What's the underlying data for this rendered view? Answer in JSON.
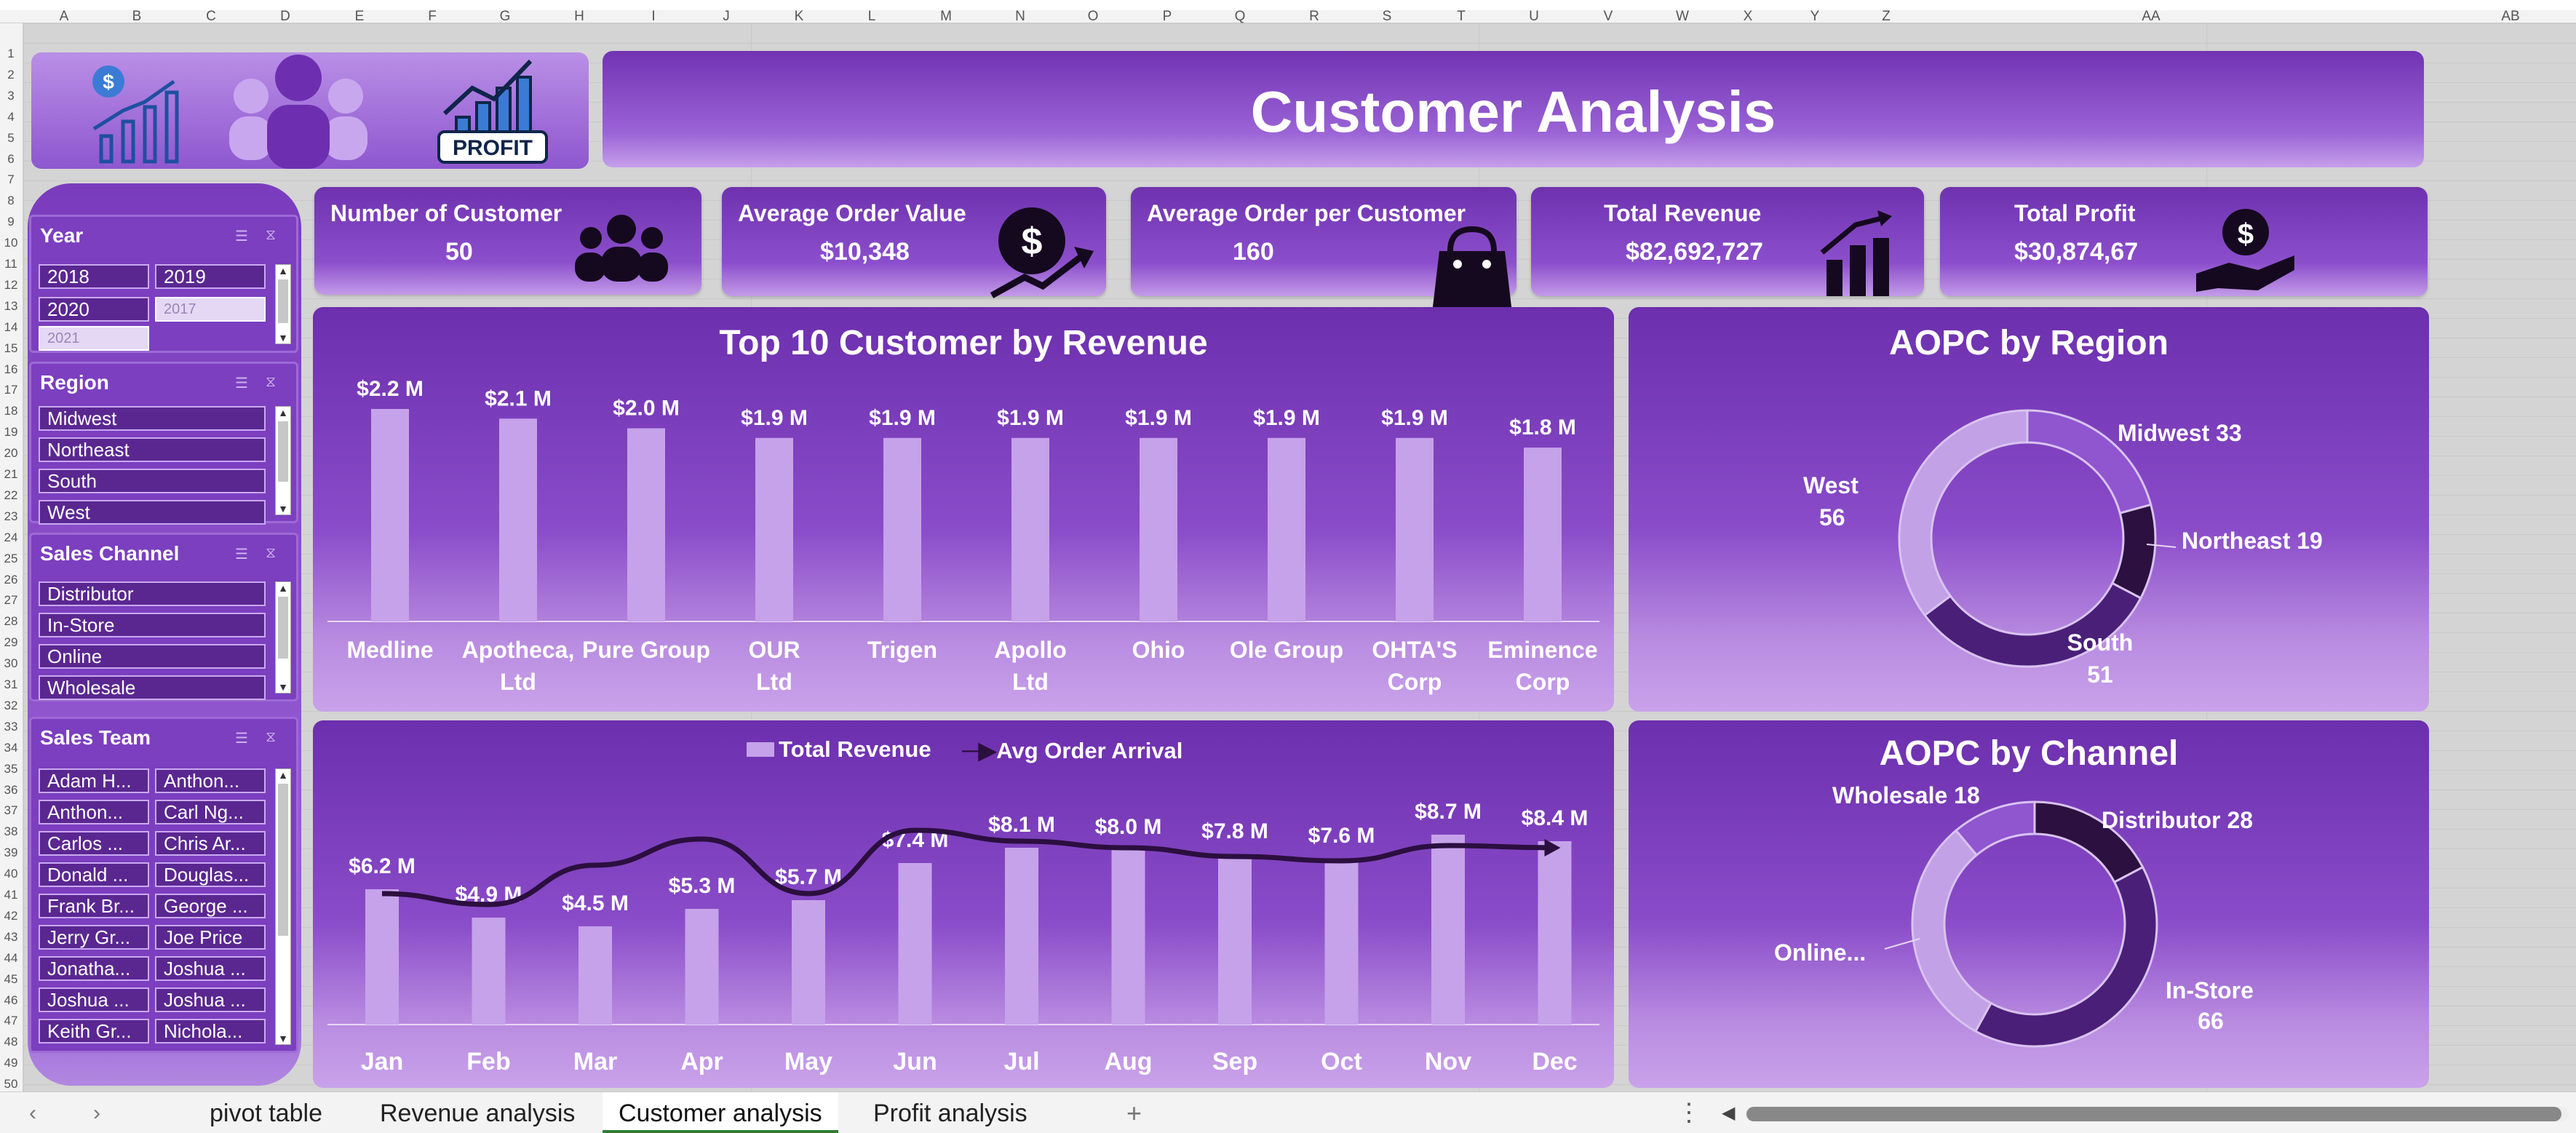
{
  "sheet": {
    "columns": [
      "A",
      "B",
      "C",
      "D",
      "E",
      "F",
      "G",
      "H",
      "I",
      "J",
      "K",
      "L",
      "M",
      "N",
      "O",
      "P",
      "Q",
      "R",
      "S",
      "T",
      "U",
      "V",
      "W",
      "X",
      "Y",
      "Z",
      "AA",
      "AB"
    ],
    "rows": [
      "1",
      "2",
      "3",
      "4",
      "5",
      "6",
      "7",
      "8",
      "9",
      "10",
      "11",
      "12",
      "13",
      "14",
      "15",
      "16",
      "17",
      "18",
      "19",
      "20",
      "21",
      "22",
      "23",
      "24",
      "25",
      "26",
      "27",
      "28",
      "29",
      "30",
      "31",
      "32",
      "33",
      "34",
      "35",
      "36",
      "37",
      "38",
      "39",
      "40",
      "41",
      "42",
      "43",
      "44",
      "45",
      "46",
      "47",
      "48",
      "49",
      "50"
    ]
  },
  "header": {
    "title": "Customer Analysis",
    "logo_badge": "PROFIT"
  },
  "kpis": [
    {
      "label": "Number of Customer",
      "value": "50",
      "icon": "people-icon"
    },
    {
      "label": "Average Order Value",
      "value": "$10,348",
      "icon": "dollar-growth-icon"
    },
    {
      "label": "Average Order per Customer",
      "value": "160",
      "icon": "shopping-bag-icon"
    },
    {
      "label": "Total Revenue",
      "value": "$82,692,727",
      "icon": "bar-growth-icon"
    },
    {
      "label": "Total Profit",
      "value": "$30,874,67",
      "icon": "money-hand-icon"
    }
  ],
  "slicers": {
    "year": {
      "title": "Year",
      "items": [
        "2018",
        "2019",
        "2020",
        "2017",
        "2021"
      ]
    },
    "region": {
      "title": "Region",
      "items": [
        "Midwest",
        "Northeast",
        "South",
        "West"
      ]
    },
    "channel": {
      "title": "Sales Channel",
      "items": [
        "Distributor",
        "In-Store",
        "Online",
        "Wholesale"
      ]
    },
    "team": {
      "title": "Sales Team",
      "items": [
        "Adam H...",
        "Anthon...",
        "Anthon...",
        "Carl Ng...",
        "Carlos ...",
        "Chris Ar...",
        "Donald ...",
        "Douglas...",
        "Frank Br...",
        "George ...",
        "Jerry Gr...",
        "Joe Price",
        "Jonatha...",
        "Joshua ...",
        "Joshua ...",
        "Joshua ...",
        "Keith Gr...",
        "Nichola..."
      ]
    }
  },
  "charts": {
    "top10_title": "Top 10 Customer by Revenue",
    "monthly_legend": {
      "bar": "Total Revenue",
      "line": "Avg Order Arrival"
    },
    "region_title": "AOPC by Region",
    "channel_title": "AOPC by Channel"
  },
  "chart_data": [
    {
      "type": "bar",
      "title": "Top 10 Customer by Revenue",
      "categories": [
        "Medline",
        "Apotheca, Ltd",
        "Pure Group",
        "OUR Ltd",
        "Trigen",
        "Apollo Ltd",
        "Ohio",
        "Ole Group",
        "OHTA'S Corp",
        "Eminence Corp"
      ],
      "values": [
        2.2,
        2.1,
        2.0,
        1.9,
        1.9,
        1.9,
        1.9,
        1.9,
        1.9,
        1.8
      ],
      "labels": [
        "$2.2 M",
        "$2.1 M",
        "$2.0 M",
        "$1.9 M",
        "$1.9 M",
        "$1.9 M",
        "$1.9 M",
        "$1.9 M",
        "$1.9 M",
        "$1.8 M"
      ]
    },
    {
      "type": "bar",
      "title": "",
      "categories": [
        "Jan",
        "Feb",
        "Mar",
        "Apr",
        "May",
        "Jun",
        "Jul",
        "Aug",
        "Sep",
        "Oct",
        "Nov",
        "Dec"
      ],
      "series": [
        {
          "name": "Total Revenue",
          "values": [
            6.2,
            4.9,
            4.5,
            5.3,
            5.7,
            7.4,
            8.1,
            8.0,
            7.8,
            7.6,
            8.7,
            8.4
          ],
          "labels": [
            "$6.2 M",
            "$4.9 M",
            "$4.5 M",
            "$5.3 M",
            "$5.7 M",
            "$7.4 M",
            "$8.1 M",
            "$8.0 M",
            "$7.8 M",
            "$7.6 M",
            "$8.7 M",
            "$8.4 M"
          ]
        },
        {
          "name": "Avg Order Arrival",
          "values": [
            6.0,
            5.5,
            7.3,
            8.5,
            6.0,
            8.9,
            8.4,
            8.1,
            7.7,
            7.5,
            8.2,
            8.1
          ]
        }
      ],
      "ylim": [
        0,
        10
      ]
    },
    {
      "type": "pie",
      "title": "AOPC by Region",
      "categories": [
        "Midwest",
        "Northeast",
        "South",
        "West"
      ],
      "values": [
        33,
        19,
        51,
        56
      ],
      "colors": [
        "#8f56cf",
        "#2b1040",
        "#4a1f78",
        "#c2a1e6"
      ]
    },
    {
      "type": "pie",
      "title": "AOPC by Channel",
      "categories": [
        "Distributor",
        "In-Store",
        "Online",
        "Wholesale"
      ],
      "values": [
        28,
        66,
        50,
        18
      ],
      "colors": [
        "#2b1040",
        "#4a1f78",
        "#c2a1e6",
        "#8f56cf"
      ],
      "labels": [
        "Distributor 28",
        "In-Store 66",
        "Online...",
        "Wholesale 18"
      ]
    }
  ],
  "tabs": [
    "pivot table",
    "Revenue analysis",
    "Customer analysis",
    "Profit analysis"
  ],
  "colors": {
    "accent": "#7b3fbf",
    "dark": "#4a1f78",
    "light": "#c9a2ea"
  }
}
